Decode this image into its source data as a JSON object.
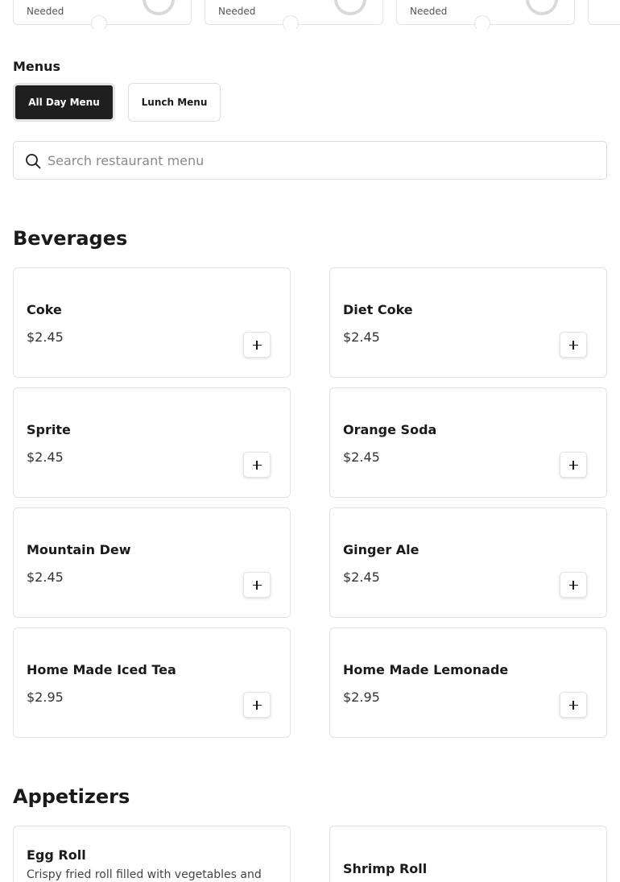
{
  "top_cards": [
    {
      "status": "Needed"
    },
    {
      "status": "Needed"
    },
    {
      "status": "Needed"
    }
  ],
  "menus": {
    "title": "Menus",
    "tabs": [
      {
        "label": "All Day Menu",
        "active": true
      },
      {
        "label": "Lunch Menu",
        "active": false
      }
    ]
  },
  "search": {
    "placeholder": "Search restaurant menu",
    "value": ""
  },
  "sections": {
    "beverages": {
      "title": "Beverages",
      "items": [
        {
          "name": "Coke",
          "price": "$2.45"
        },
        {
          "name": "Diet Coke",
          "price": "$2.45"
        },
        {
          "name": "Sprite",
          "price": "$2.45"
        },
        {
          "name": "Orange Soda",
          "price": "$2.45"
        },
        {
          "name": "Mountain Dew",
          "price": "$2.45"
        },
        {
          "name": "Ginger Ale",
          "price": "$2.45"
        },
        {
          "name": "Home Made Iced Tea",
          "price": "$2.95"
        },
        {
          "name": "Home Made Lemonade",
          "price": "$2.95"
        }
      ]
    },
    "appetizers": {
      "title": "Appetizers",
      "items": [
        {
          "name": "Egg Roll",
          "description": "Crispy fried roll filled with vegetables and"
        },
        {
          "name": "Shrimp Roll"
        }
      ]
    }
  },
  "colors": {
    "active_tab_bg": "#1f1f1f",
    "card_border": "#e2e2e2",
    "text": "#1a1a1a"
  }
}
